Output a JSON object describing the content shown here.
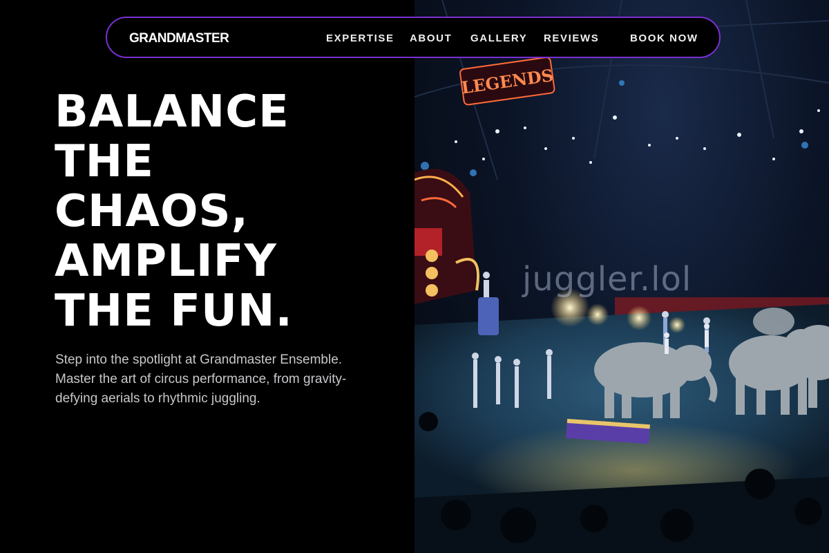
{
  "brand": "GRANDMASTER",
  "nav": {
    "links": [
      "EXPERTISE",
      "ABOUT",
      "GALLERY",
      "REVIEWS"
    ],
    "cta": "BOOK NOW"
  },
  "hero": {
    "headline_lines": [
      "BALANCE",
      "THE",
      "CHAOS,",
      "AMPLIFY",
      "THE FUN."
    ],
    "subtext": "Step into the spotlight at Grandmaster Ensemble. Master the art of circus performance, from gravity-defying aerials to rhythmic juggling."
  },
  "image": {
    "watermark": "juggler.lol",
    "sign_text": "LEGENDS"
  },
  "colors": {
    "background": "#000000",
    "nav_border": "#7a2fd1",
    "text": "#ffffff",
    "subtext": "#c8c8cc"
  }
}
